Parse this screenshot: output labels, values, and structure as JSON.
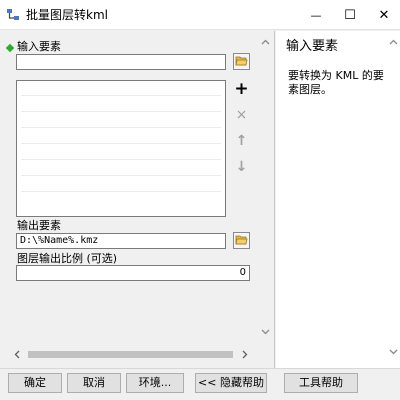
{
  "window": {
    "title": "批量图层转kml",
    "minimize_glyph": "—",
    "maximize_glyph": "☐",
    "close_glyph": "✕"
  },
  "form": {
    "input_features_label": "输入要素",
    "input_features_value": "",
    "output_features_label": "输出要素",
    "output_features_value": "D:\\%Name%.kmz",
    "scale_label": "图层输出比例 (可选)",
    "scale_value": "0"
  },
  "list_tools": {
    "add": "+",
    "remove": "×",
    "up": "↑",
    "down": "↓"
  },
  "help": {
    "title": "输入要素",
    "body": "要转换为 KML 的要素图层。"
  },
  "buttons": {
    "ok": "确定",
    "cancel": "取消",
    "environments": "环境...",
    "hide_help": "<< 隐藏帮助",
    "tool_help": "工具帮助"
  },
  "icons": {
    "title_icon": "toolbox-script-icon",
    "folder": "open-folder-icon"
  },
  "colors": {
    "required_marker": "#2eaa2e",
    "folder": "#e8b84a"
  }
}
